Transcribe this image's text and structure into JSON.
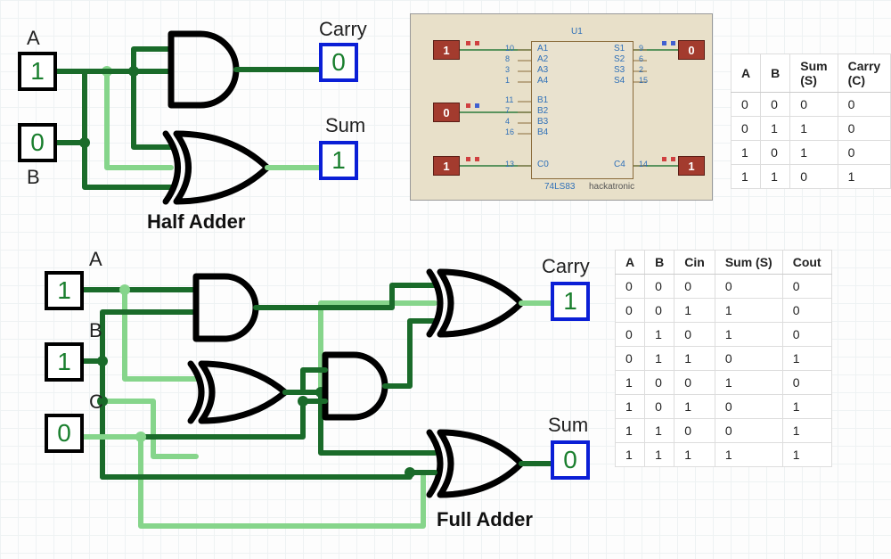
{
  "half_adder": {
    "title": "Half Adder",
    "inputs": {
      "A": {
        "label": "A",
        "value": "1"
      },
      "B": {
        "label": "B",
        "value": "0"
      }
    },
    "outputs": {
      "carry": {
        "label": "Carry",
        "value": "0"
      },
      "sum": {
        "label": "Sum",
        "value": "1"
      }
    },
    "truth_table": {
      "headers": [
        "A",
        "B",
        "Sum (S)",
        "Carry (C)"
      ],
      "rows": [
        [
          "0",
          "0",
          "0",
          "0"
        ],
        [
          "0",
          "1",
          "1",
          "0"
        ],
        [
          "1",
          "0",
          "1",
          "0"
        ],
        [
          "1",
          "1",
          "0",
          "1"
        ]
      ]
    }
  },
  "full_adder": {
    "title": "Full Adder",
    "inputs": {
      "A": {
        "label": "A",
        "value": "1"
      },
      "B": {
        "label": "B",
        "value": "1"
      },
      "C": {
        "label": "C",
        "value": "0"
      }
    },
    "outputs": {
      "carry": {
        "label": "Carry",
        "value": "1"
      },
      "sum": {
        "label": "Sum",
        "value": "0"
      }
    },
    "truth_table": {
      "headers": [
        "A",
        "B",
        "Cin",
        "Sum (S)",
        "Cout"
      ],
      "rows": [
        [
          "0",
          "0",
          "0",
          "0",
          "0"
        ],
        [
          "0",
          "0",
          "1",
          "1",
          "0"
        ],
        [
          "0",
          "1",
          "0",
          "1",
          "0"
        ],
        [
          "0",
          "1",
          "1",
          "0",
          "1"
        ],
        [
          "1",
          "0",
          "0",
          "1",
          "0"
        ],
        [
          "1",
          "0",
          "1",
          "0",
          "1"
        ],
        [
          "1",
          "1",
          "0",
          "0",
          "1"
        ],
        [
          "1",
          "1",
          "1",
          "1",
          "1"
        ]
      ]
    }
  },
  "proteus": {
    "chip_ref": "U1",
    "chip_part": "74LS83",
    "brand": "hackatronic",
    "left_pins": [
      {
        "num": "10",
        "name": "A1"
      },
      {
        "num": "8",
        "name": "A2"
      },
      {
        "num": "3",
        "name": "A3"
      },
      {
        "num": "1",
        "name": "A4"
      },
      {
        "num": "11",
        "name": "B1"
      },
      {
        "num": "7",
        "name": "B2"
      },
      {
        "num": "4",
        "name": "B3"
      },
      {
        "num": "16",
        "name": "B4"
      },
      {
        "num": "13",
        "name": "C0"
      }
    ],
    "right_pins": [
      {
        "num": "9",
        "name": "S1"
      },
      {
        "num": "6",
        "name": "S2"
      },
      {
        "num": "2",
        "name": "S3"
      },
      {
        "num": "15",
        "name": "S4"
      },
      {
        "num": "14",
        "name": "C4"
      }
    ],
    "logic_inputs": [
      {
        "label": "1"
      },
      {
        "label": "0"
      },
      {
        "label": "1"
      }
    ],
    "logic_outputs": [
      {
        "label": "0"
      },
      {
        "label": "1"
      }
    ]
  }
}
